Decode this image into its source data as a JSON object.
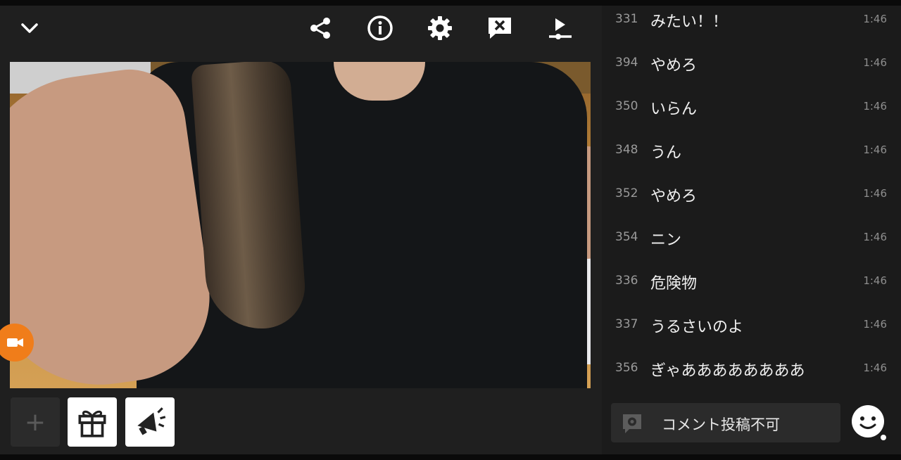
{
  "toolbar": {
    "icons": [
      "chevron-down-icon",
      "share-icon",
      "info-icon",
      "gear-icon",
      "comment-hide-icon",
      "playlist-icon"
    ]
  },
  "bottom_tiles": {
    "add_label": "+"
  },
  "comments": [
    {
      "no": "331",
      "text": "みたい！！",
      "time": "1:46"
    },
    {
      "no": "394",
      "text": "やめろ",
      "time": "1:46"
    },
    {
      "no": "350",
      "text": "いらん",
      "time": "1:46"
    },
    {
      "no": "348",
      "text": "うん",
      "time": "1:46"
    },
    {
      "no": "352",
      "text": "やめろ",
      "time": "1:46"
    },
    {
      "no": "354",
      "text": "ニン",
      "time": "1:46"
    },
    {
      "no": "336",
      "text": "危険物",
      "time": "1:46"
    },
    {
      "no": "337",
      "text": "うるさいのよ",
      "time": "1:46"
    },
    {
      "no": "356",
      "text": "ぎゃああああああああ",
      "time": "1:46"
    }
  ],
  "comment_input": {
    "placeholder": "コメント投稿不可"
  },
  "colors": {
    "accent": "#f07d1a",
    "background": "#1b1b1b"
  }
}
